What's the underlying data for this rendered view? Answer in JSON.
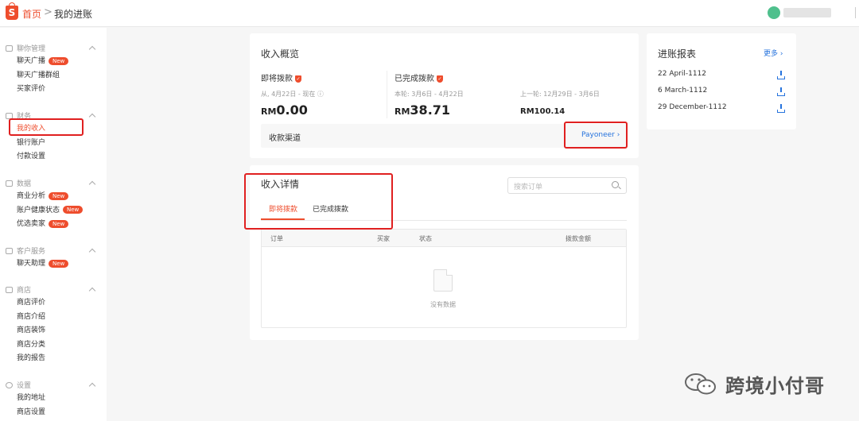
{
  "header": {
    "logo_letter": "S",
    "breadcrumb_home": "首页",
    "breadcrumb_sep": ">",
    "breadcrumb_current": "我的进账"
  },
  "sidebar": {
    "sections": [
      {
        "title": "聊你管理",
        "items": [
          {
            "label": "聊天广播",
            "badge": "New"
          },
          {
            "label": "聊天广播群组"
          },
          {
            "label": "买家评价"
          }
        ]
      },
      {
        "title": "财务",
        "items": [
          {
            "label": "我的收入",
            "active": true
          },
          {
            "label": "银行账户"
          },
          {
            "label": "付款设置"
          }
        ]
      },
      {
        "title": "数据",
        "items": [
          {
            "label": "商业分析",
            "badge": "New"
          },
          {
            "label": "账户健康状态",
            "badge": "New"
          },
          {
            "label": "优选卖家",
            "badge": "New"
          }
        ]
      },
      {
        "title": "客户服务",
        "items": [
          {
            "label": "聊天助理",
            "badge": "New"
          }
        ]
      },
      {
        "title": "商店",
        "items": [
          {
            "label": "商店评价"
          },
          {
            "label": "商店介绍"
          },
          {
            "label": "商店装饰"
          },
          {
            "label": "商店分类"
          },
          {
            "label": "我的报告"
          }
        ]
      },
      {
        "title": "设置",
        "items": [
          {
            "label": "我的地址"
          },
          {
            "label": "商店设置"
          }
        ]
      }
    ]
  },
  "overview": {
    "title": "收入概览",
    "pending_label": "即将拨款",
    "pending_period": "从, 4月22日 - 现在 ⓘ",
    "pending_currency": "RM",
    "pending_amount": "0.00",
    "completed_label": "已完成拨款",
    "completed_period": "本轮: 3月6日 - 4月22日",
    "completed_currency": "RM",
    "completed_amount": "38.71",
    "previous_period": "上一轮: 12月29日 - 3月6日",
    "previous_amount": "RM100.14",
    "channel_label": "收款渠道",
    "channel_value": "Payoneer"
  },
  "details": {
    "title": "收入详情",
    "search_placeholder": "搜索订单",
    "tabs": [
      "即将拨款",
      "已完成拨款"
    ],
    "columns": [
      "订单",
      "买家",
      "状态",
      "拨款金额"
    ],
    "empty_text": "没有数据"
  },
  "report": {
    "title": "进账报表",
    "more": "更多",
    "items": [
      "22 April-1112",
      "6 March-1112",
      "29 December-1112"
    ]
  },
  "watermark": {
    "text": "跨境小付哥"
  },
  "colors": {
    "brand": "#ee4d2d",
    "link": "#2673dd",
    "highlight": "#e02020"
  }
}
